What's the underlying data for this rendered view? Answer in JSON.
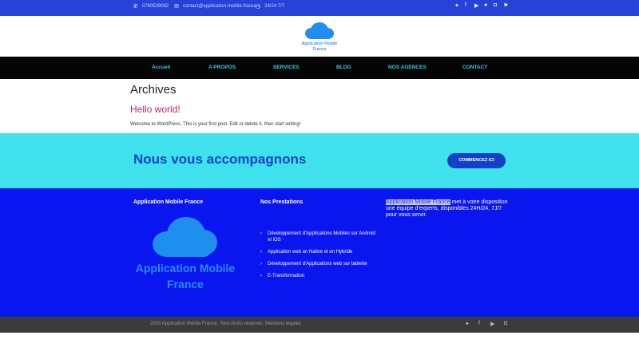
{
  "topbar": {
    "phone": "0780539062",
    "email": "contact@application-mobile-france",
    "hours": "24/24 7/7",
    "phone_icon": "phone-icon",
    "email_icon": "envelope-icon",
    "hours_icon": "clock-icon",
    "social": [
      "twitter-icon",
      "facebook-icon",
      "youtube-icon",
      "pinterest-icon",
      "instagram-icon",
      "foursquare-icon"
    ]
  },
  "header": {
    "logo_text_line1": "Application Mobile",
    "logo_text_line2": "France"
  },
  "nav": {
    "items": [
      "Accueil",
      "A PROPOS",
      "SERVICES",
      "BLOG",
      "NOS AGENCES",
      "CONTACT"
    ]
  },
  "main": {
    "archives_title": "Archives",
    "post_title": "Hello world!",
    "post_excerpt": "Welcome to WordPress. This is your first post. Edit or delete it, then start writing!"
  },
  "cta": {
    "heading": "Nous vous accompagnons",
    "button_label": "COMMENCEZ ICI"
  },
  "footer": {
    "col1_title": "Application Mobile France",
    "brand_line1": "Application Mobile",
    "brand_line2": "France",
    "col2_title": "Nos Prestations",
    "services": [
      "Développement d'Applications Mobiles sur Android et iOS",
      "Application web en Native et en Hybride",
      "Développement d'Applications web sur tablette",
      "E-Transformation"
    ],
    "about_highlight": "Application Mobile France",
    "about_rest": " met à votre disposition une équipe d'experts, disponibles 24H/24, 7J/7 pour vous servir."
  },
  "bottombar": {
    "copyright": "2020 Application Mobile France. Tous droits réservés. Mentions légales",
    "social": [
      "twitter-icon",
      "facebook-icon",
      "youtube-icon",
      "instagram-icon"
    ]
  },
  "colors": {
    "topbar": "#2742d6",
    "nav": "#050505",
    "nav_text": "#29d0e6",
    "cta_bg": "#3fe2ec",
    "footer_bg": "#0a16ef",
    "post_title": "#c3246a"
  }
}
